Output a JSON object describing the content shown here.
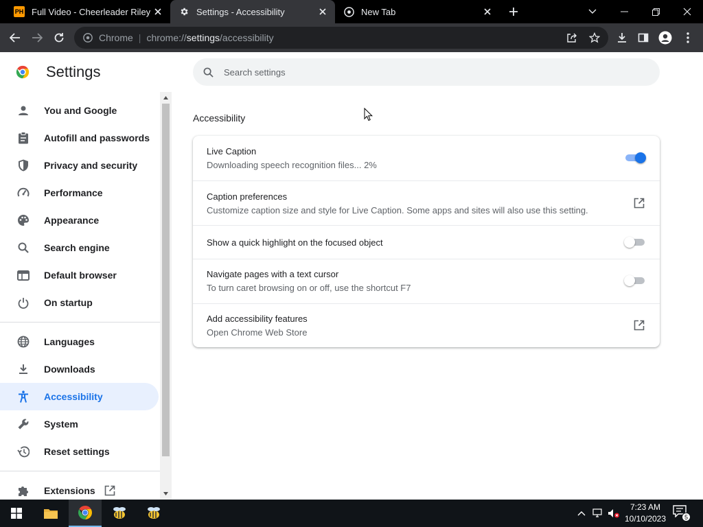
{
  "tabs": [
    {
      "title": "Full Video - Cheerleader Riley Re",
      "icon": "ph-icon",
      "favicon_text": "PH"
    },
    {
      "title": "Settings - Accessibility",
      "icon": "gear-icon"
    },
    {
      "title": "New Tab",
      "icon": "chrome-icon"
    }
  ],
  "omnibox": {
    "chip": "Chrome",
    "url_scheme": "chrome://",
    "url_host": "settings",
    "url_path": "/accessibility"
  },
  "settings": {
    "title": "Settings",
    "search_placeholder": "Search settings"
  },
  "sidebar": {
    "items": [
      {
        "label": "You and Google",
        "icon": "person-icon"
      },
      {
        "label": "Autofill and passwords",
        "icon": "clipboard-icon"
      },
      {
        "label": "Privacy and security",
        "icon": "shield-icon"
      },
      {
        "label": "Performance",
        "icon": "gauge-icon"
      },
      {
        "label": "Appearance",
        "icon": "palette-icon"
      },
      {
        "label": "Search engine",
        "icon": "search-icon"
      },
      {
        "label": "Default browser",
        "icon": "browser-window-icon"
      },
      {
        "label": "On startup",
        "icon": "power-icon"
      },
      {
        "label": "Languages",
        "icon": "globe-icon"
      },
      {
        "label": "Downloads",
        "icon": "download-icon"
      },
      {
        "label": "Accessibility",
        "icon": "accessibility-icon",
        "selected": true
      },
      {
        "label": "System",
        "icon": "wrench-icon"
      },
      {
        "label": "Reset settings",
        "icon": "history-icon"
      },
      {
        "label": "Extensions",
        "icon": "puzzle-icon"
      }
    ]
  },
  "main": {
    "section_title": "Accessibility",
    "rows": [
      {
        "primary": "Live Caption",
        "secondary": "Downloading speech recognition files... 2%",
        "control": "toggle",
        "on": true
      },
      {
        "primary": "Caption preferences",
        "secondary": "Customize caption size and style for Live Caption. Some apps and sites will also use this setting.",
        "control": "external-link"
      },
      {
        "primary": "Show a quick highlight on the focused object",
        "control": "toggle",
        "on": false
      },
      {
        "primary": "Navigate pages with a text cursor",
        "secondary": "To turn caret browsing on or off, use the shortcut F7",
        "control": "toggle",
        "on": false
      },
      {
        "primary": "Add accessibility features",
        "secondary": "Open Chrome Web Store",
        "control": "external-link"
      }
    ]
  },
  "taskbar": {
    "time": "7:23 AM",
    "date": "10/10/2023",
    "notifications": "5"
  },
  "colors": {
    "accent": "#1a73e8",
    "selected_bg": "#e8f0fe",
    "tabstrip": "#000000",
    "toolbar": "#35363a"
  }
}
